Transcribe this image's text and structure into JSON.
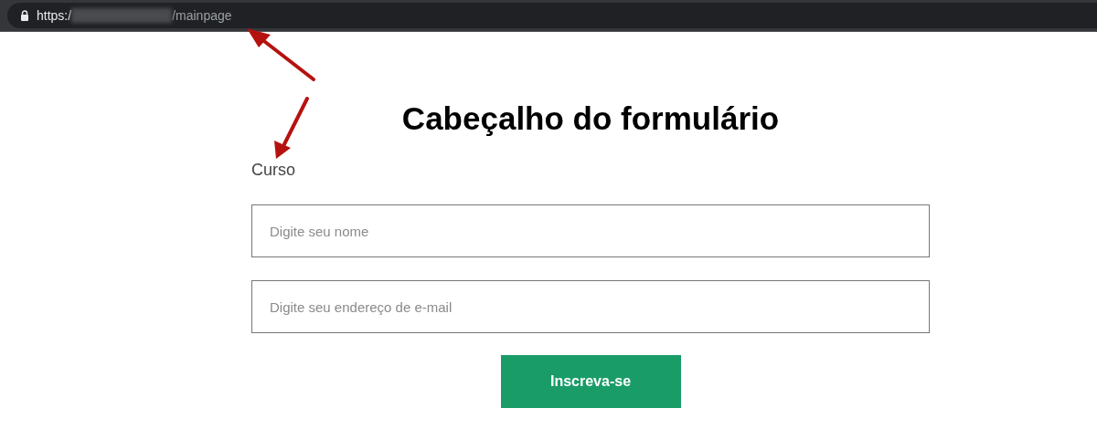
{
  "address_bar": {
    "scheme": "https:/",
    "path": "/mainpage"
  },
  "form": {
    "title": "Cabeçalho do formulário",
    "label": "Curso",
    "fields": [
      {
        "placeholder": "Digite seu nome"
      },
      {
        "placeholder": "Digite seu endereço de e-mail"
      }
    ],
    "submit": "Inscreva-se"
  }
}
